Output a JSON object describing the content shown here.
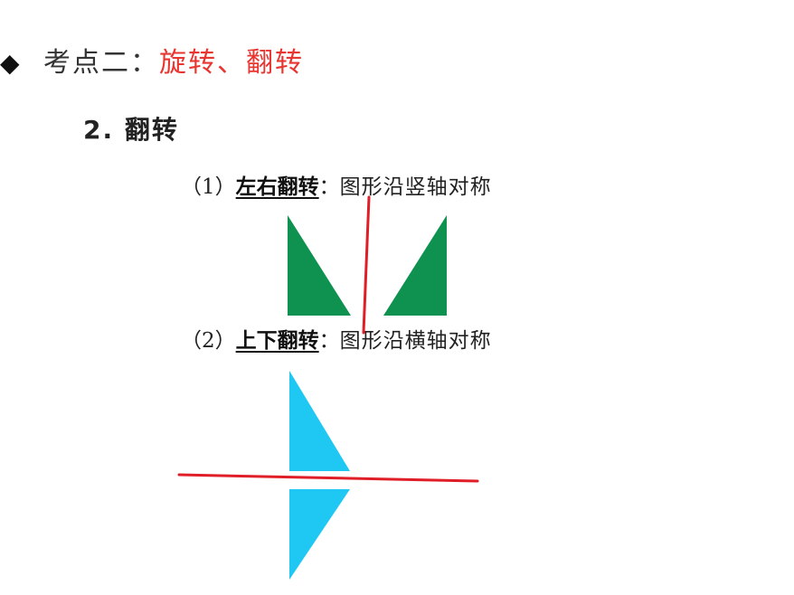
{
  "heading": {
    "bullet": "◆",
    "label": "考点二：",
    "topic": "旋转、翻转"
  },
  "subheading": "2. 翻转",
  "items": [
    {
      "num": "（1）",
      "term": "左右翻转",
      "colon": "：",
      "desc": "图形沿竖轴对称"
    },
    {
      "num": "（2）",
      "term": "上下翻转",
      "colon": "：",
      "desc": "图形沿横轴对称"
    }
  ],
  "colors": {
    "accent_red": "#e8352f",
    "green_triangle": "#0f9150",
    "cyan_triangle": "#1ec8f2",
    "annotation_red": "#e01e28"
  },
  "icons": {
    "bullet": "diamond-bullet-icon"
  }
}
